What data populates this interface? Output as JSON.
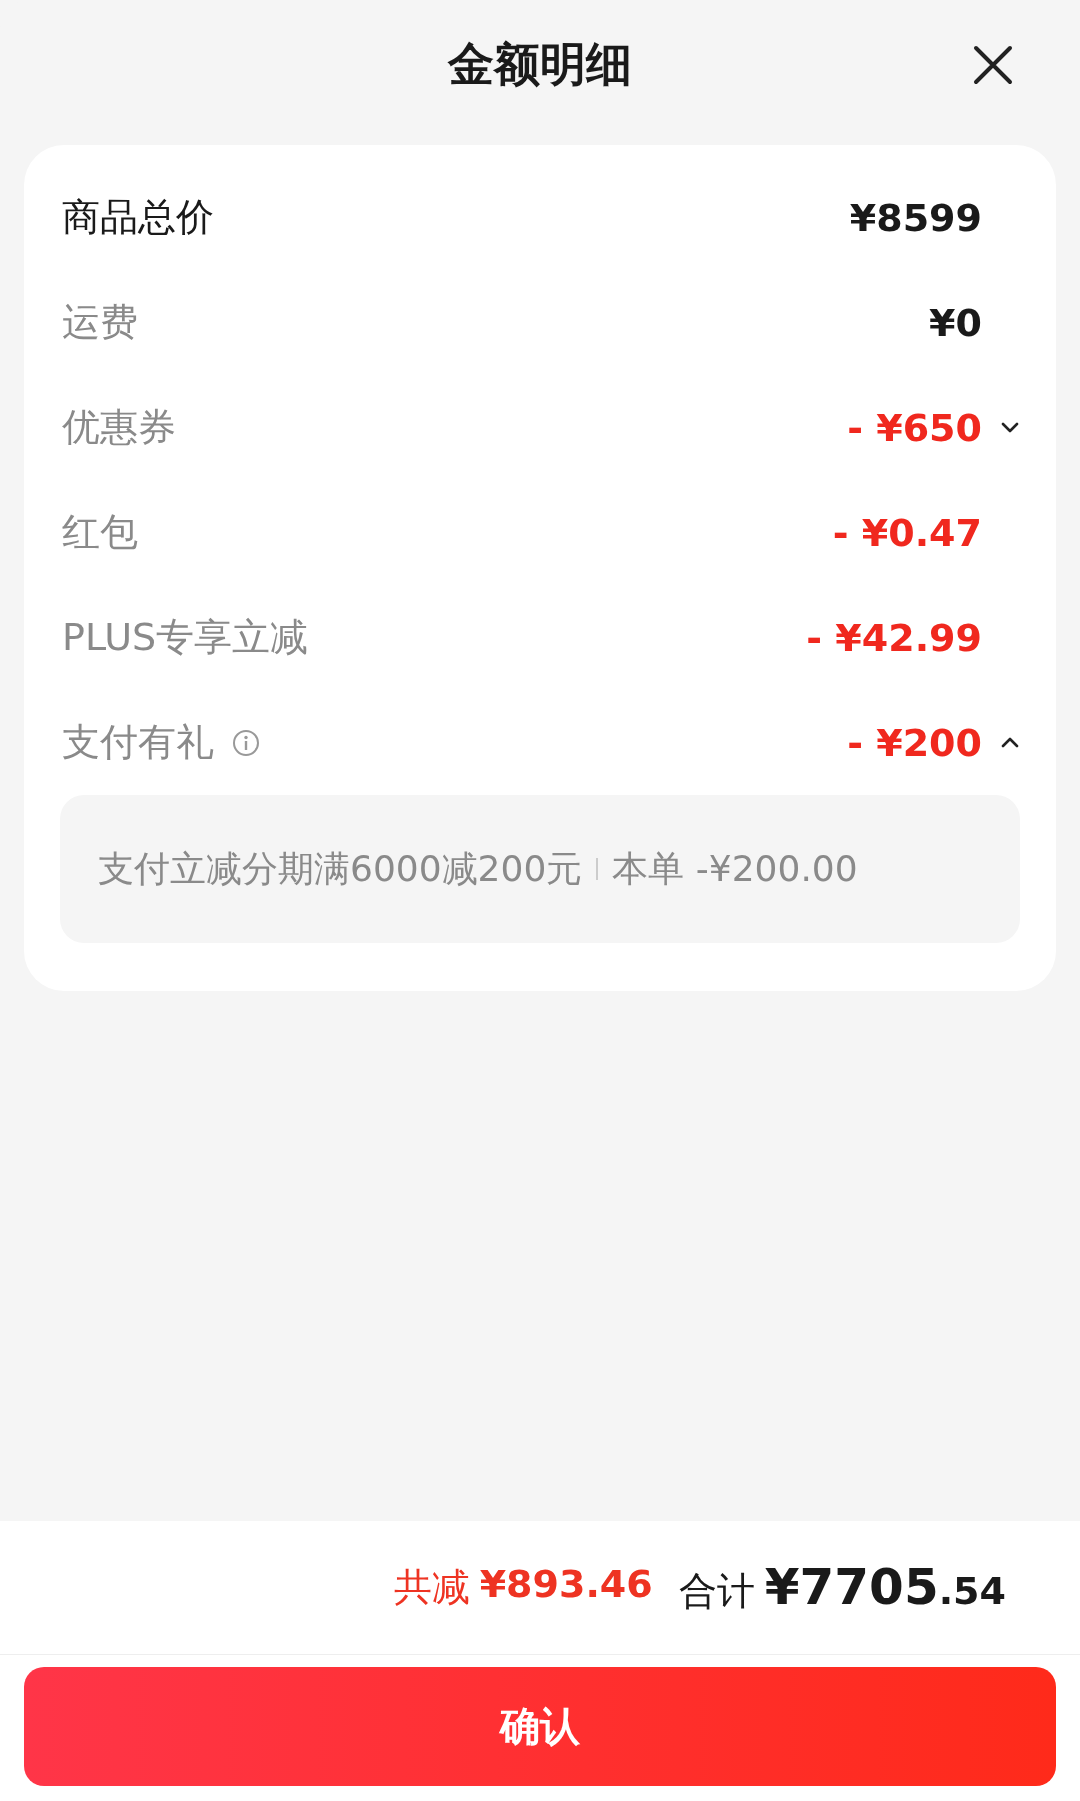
{
  "header": {
    "title": "金额明细"
  },
  "rows": [
    {
      "kind": "subtotal",
      "label": "商品总价",
      "value": "¥8599"
    },
    {
      "kind": "charge",
      "label": "运费",
      "value": "¥0"
    },
    {
      "kind": "discount",
      "label": "优惠券",
      "value": "- ¥650",
      "expanded": false
    },
    {
      "kind": "discount",
      "label": "红包",
      "value": "- ¥0.47"
    },
    {
      "kind": "discount",
      "label": "PLUS专享立减",
      "value": "- ¥42.99"
    },
    {
      "kind": "discount",
      "label": "支付有礼",
      "value": "- ¥200",
      "info": true,
      "expanded": true,
      "detail": {
        "text": "支付立减分期满6000减200元",
        "amount": "本单 -¥200.00"
      }
    }
  ],
  "footer": {
    "saved_label": "共减",
    "saved": "¥893.46",
    "total_label": "合计",
    "total": "¥7705.54"
  },
  "confirm_button": "确认"
}
